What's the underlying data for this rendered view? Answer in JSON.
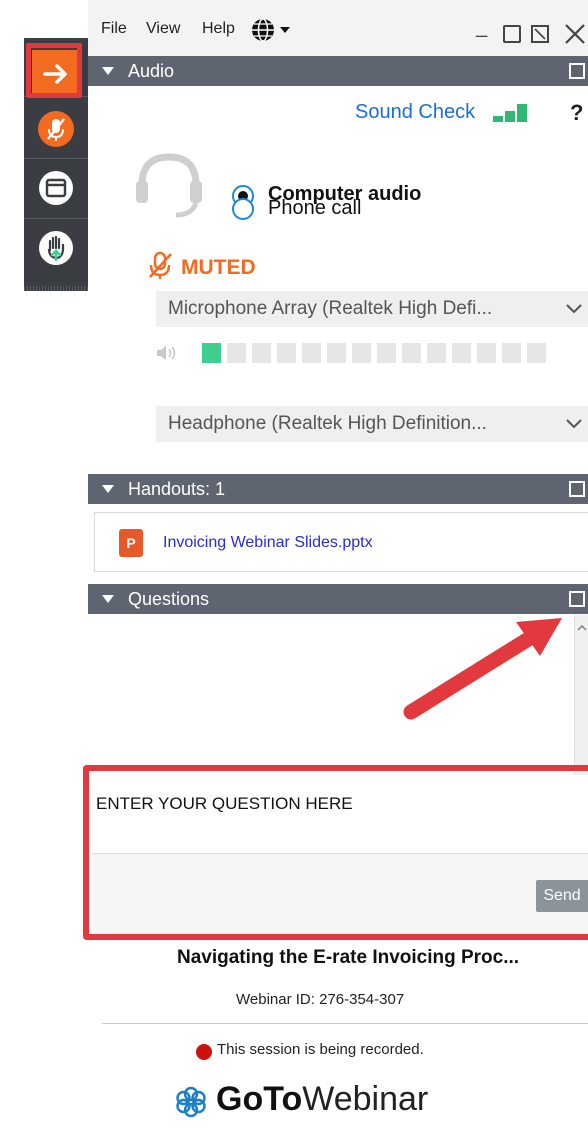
{
  "menu": {
    "file": "File",
    "view": "View",
    "help": "Help"
  },
  "audio": {
    "header": "Audio",
    "sound_check": "Sound Check",
    "help_mark": "?",
    "computer_audio": "Computer audio",
    "phone_call": "Phone call",
    "selected_option": "Computer audio",
    "muted_label": "MUTED",
    "microphone_device": "Microphone Array (Realtek High Defi...",
    "speaker_level_active_segments": 1,
    "speaker_level_total_segments": 14,
    "headphone_device": "Headphone (Realtek High Definition..."
  },
  "handouts": {
    "header": "Handouts: 1",
    "files": [
      {
        "name": "Invoicing Webinar Slides.pptx",
        "type_badge": "P"
      }
    ]
  },
  "questions": {
    "header": "Questions",
    "input_placeholder": "ENTER YOUR QUESTION HERE",
    "send_label": "Send"
  },
  "webinar": {
    "title": "Navigating the E-rate Invoicing Proc...",
    "id_text": "Webinar ID: 276-354-307",
    "recording_notice": "This session is being recorded.",
    "brand_bold": "GoTo",
    "brand_light": "Webinar"
  },
  "colors": {
    "accent_orange": "#f26b21",
    "header_gray": "#5e6570",
    "link_blue": "#1a6fd4",
    "level_green": "#3ecf8e",
    "annotation_red": "#e2393f",
    "record_red": "#cc1111"
  },
  "icons": {
    "toolbar": [
      "collapse-arrow-icon",
      "microphone-muted-icon",
      "window-icon",
      "raise-hand-icon"
    ],
    "menu": [
      "globe-language-icon"
    ],
    "audio": [
      "headset-icon",
      "muted-mic-icon",
      "speaker-volume-icon"
    ],
    "brand": [
      "gotowebinar-flower-logo"
    ]
  }
}
